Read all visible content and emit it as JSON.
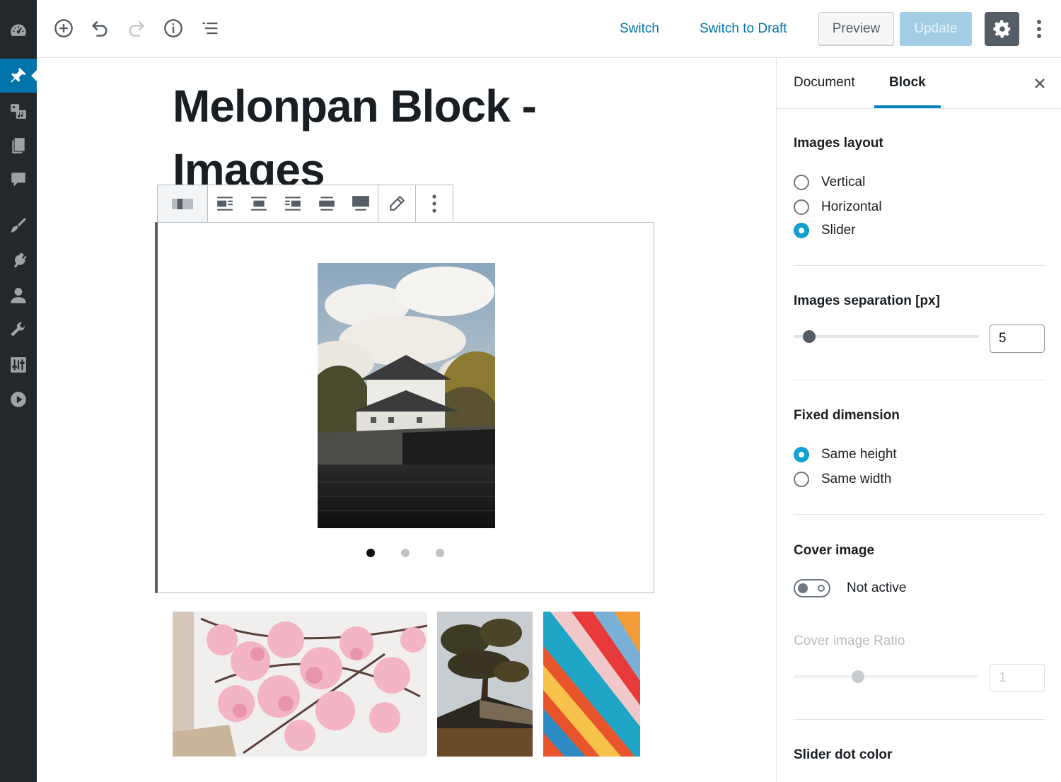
{
  "admin_menu": {
    "items": [
      "dashboard-icon",
      "pin-icon",
      "media-icon",
      "pages-icon",
      "comments-icon",
      "appearance-icon",
      "plugins-icon",
      "users-icon",
      "tools-icon",
      "settings-icon",
      "video-icon"
    ],
    "active_item": "pin-icon",
    "colors": {
      "background": "#23282d",
      "active": "#0073aa"
    }
  },
  "topbar": {
    "switch_label": "Switch",
    "switch_to_draft_label": "Switch to Draft",
    "preview_label": "Preview",
    "update_label": "Update",
    "link_color": "#0073aa"
  },
  "editor": {
    "title_line1": "Melonpan Block -",
    "title_line2": "Images",
    "block_toolbar": {
      "tools": [
        "block-type-icon",
        "align-left-icon",
        "align-center-icon",
        "align-right-icon",
        "wide-width-icon",
        "full-width-icon",
        "edit-pencil-icon",
        "more-options-icon"
      ]
    },
    "slider": {
      "current_slide": 1,
      "total_slides": 3
    }
  },
  "sidebar": {
    "tabs": {
      "document": "Document",
      "block": "Block"
    },
    "active_tab": "Block",
    "images_layout": {
      "title": "Images layout",
      "options": [
        "Vertical",
        "Horizontal",
        "Slider"
      ],
      "selected": "Slider"
    },
    "images_separation": {
      "title": "Images separation [px]",
      "value": "5",
      "slider_fraction": 0.05
    },
    "fixed_dimension": {
      "title": "Fixed dimension",
      "options": [
        "Same height",
        "Same width"
      ],
      "selected": "Same height"
    },
    "cover_image": {
      "title": "Cover image",
      "toggle_label": "Not active",
      "active": false
    },
    "cover_image_ratio": {
      "title": "Cover image Ratio",
      "value": "1",
      "slider_fraction": 0.34,
      "disabled": true
    },
    "slider_dot_color": {
      "title": "Slider dot color"
    },
    "accent_color": "#11a0d2"
  }
}
